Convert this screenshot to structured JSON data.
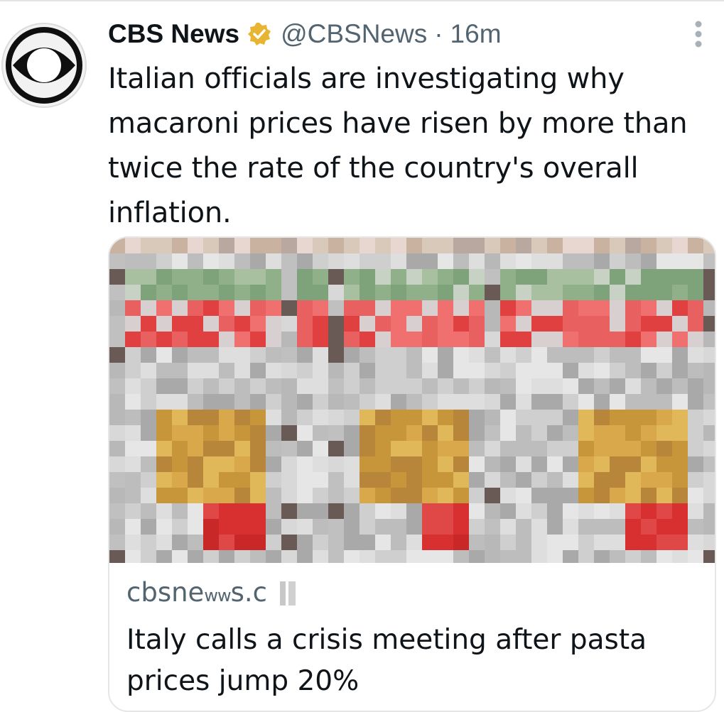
{
  "tweet": {
    "display_name": "CBS News",
    "handle": "@CBSNews",
    "separator": "·",
    "time_ago": "16m",
    "text": "Italian officials are investigating why macaroni prices have risen by more than twice the rate of the country's overall inflation.",
    "verified_badge_color": "#e8b532"
  },
  "card": {
    "domain_visible": "cbsne\u0000s.c",
    "domain_prefix": "cbsne",
    "domain_suffix": "s.c",
    "title": "Italy calls a crisis meeting after pasta prices jump 20%",
    "image_state": "pixelated (censored) photo of pasta boxes"
  },
  "icons": {
    "avatar": "cbs-eye-logo-icon",
    "verified": "verified-badge-icon",
    "more": "more-vertical-icon"
  },
  "colors": {
    "text_primary": "#0f1419",
    "text_secondary": "#536471",
    "card_border": "#e6e6e6"
  }
}
